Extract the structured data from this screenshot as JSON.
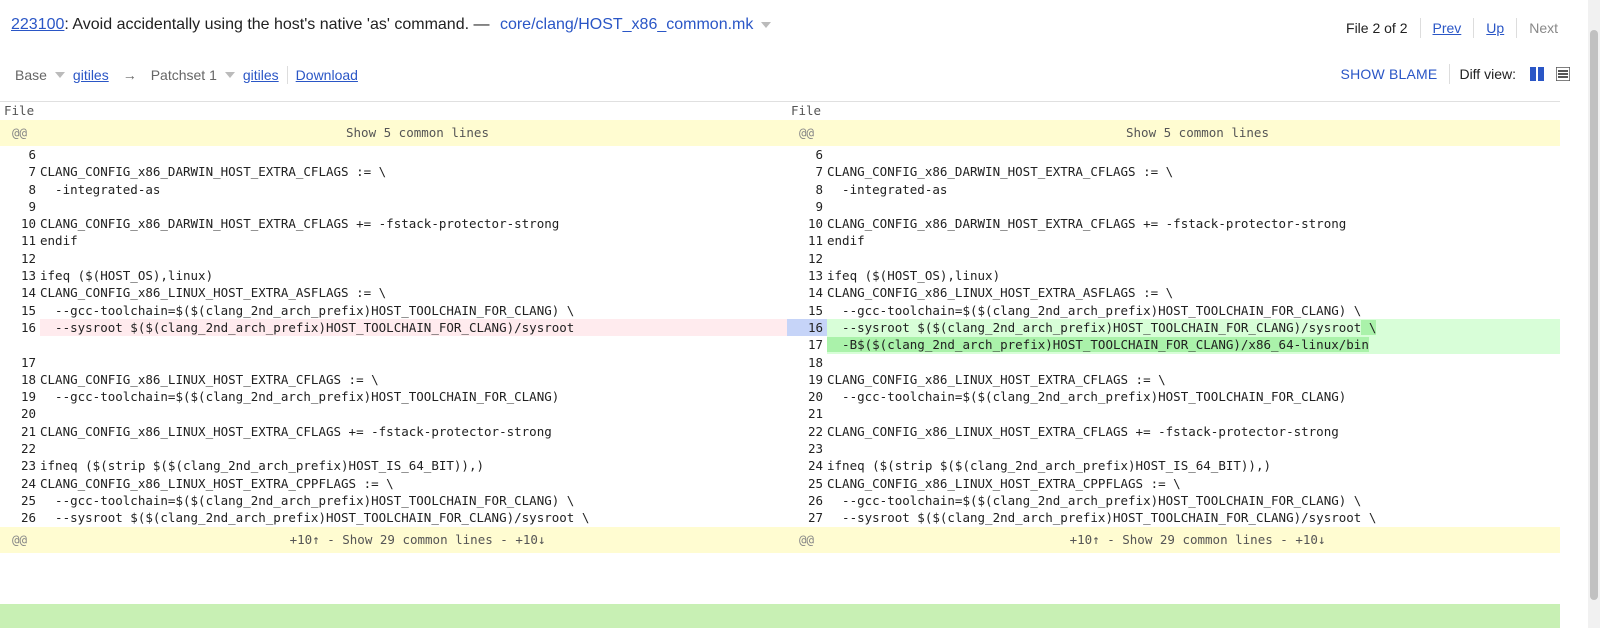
{
  "header": {
    "change_number": "223100",
    "subject": ": Avoid accidentally using the host's native 'as' command. —",
    "file_path": "core/clang/HOST_x86_common.mk",
    "file_position": "File 2 of 2",
    "prev_label": "Prev",
    "up_label": "Up",
    "next_label": "Next"
  },
  "subheader": {
    "base_label": "Base",
    "base_gitiles": "gitiles",
    "arrow": "→",
    "patchset_label": "Patchset 1",
    "patchset_gitiles": "gitiles",
    "download_label": "Download",
    "show_blame_label": "SHOW BLAME",
    "diff_view_label": "Diff view:"
  },
  "diff": {
    "file_label": "File",
    "context_marker": "@@",
    "top_context": "Show 5 common lines",
    "bottom_context": "+10↑  -  Show 29 common lines  -  +10↓",
    "left": [
      {
        "n": "6",
        "t": ""
      },
      {
        "n": "7",
        "t": "CLANG_CONFIG_x86_DARWIN_HOST_EXTRA_CFLAGS := \\"
      },
      {
        "n": "8",
        "t": "  -integrated-as"
      },
      {
        "n": "9",
        "t": ""
      },
      {
        "n": "10",
        "t": "CLANG_CONFIG_x86_DARWIN_HOST_EXTRA_CFLAGS += -fstack-protector-strong"
      },
      {
        "n": "11",
        "t": "endif"
      },
      {
        "n": "12",
        "t": ""
      },
      {
        "n": "13",
        "t": "ifeq ($(HOST_OS),linux)"
      },
      {
        "n": "14",
        "t": "CLANG_CONFIG_x86_LINUX_HOST_EXTRA_ASFLAGS := \\"
      },
      {
        "n": "15",
        "t": "  --gcc-toolchain=$($(clang_2nd_arch_prefix)HOST_TOOLCHAIN_FOR_CLANG) \\"
      },
      {
        "n": "16",
        "t": "  --sysroot $($(clang_2nd_arch_prefix)HOST_TOOLCHAIN_FOR_CLANG)/sysroot",
        "k": "rm"
      },
      {
        "n": "",
        "t": "",
        "k": "blank"
      },
      {
        "n": "17",
        "t": ""
      },
      {
        "n": "18",
        "t": "CLANG_CONFIG_x86_LINUX_HOST_EXTRA_CFLAGS := \\"
      },
      {
        "n": "19",
        "t": "  --gcc-toolchain=$($(clang_2nd_arch_prefix)HOST_TOOLCHAIN_FOR_CLANG)"
      },
      {
        "n": "20",
        "t": ""
      },
      {
        "n": "21",
        "t": "CLANG_CONFIG_x86_LINUX_HOST_EXTRA_CFLAGS += -fstack-protector-strong"
      },
      {
        "n": "22",
        "t": ""
      },
      {
        "n": "23",
        "t": "ifneq ($(strip $($(clang_2nd_arch_prefix)HOST_IS_64_BIT)),)"
      },
      {
        "n": "24",
        "t": "CLANG_CONFIG_x86_LINUX_HOST_EXTRA_CPPFLAGS := \\"
      },
      {
        "n": "25",
        "t": "  --gcc-toolchain=$($(clang_2nd_arch_prefix)HOST_TOOLCHAIN_FOR_CLANG) \\"
      },
      {
        "n": "26",
        "t": "  --sysroot $($(clang_2nd_arch_prefix)HOST_TOOLCHAIN_FOR_CLANG)/sysroot \\"
      }
    ],
    "right": [
      {
        "n": "6",
        "t": ""
      },
      {
        "n": "7",
        "t": "CLANG_CONFIG_x86_DARWIN_HOST_EXTRA_CFLAGS := \\"
      },
      {
        "n": "8",
        "t": "  -integrated-as"
      },
      {
        "n": "9",
        "t": ""
      },
      {
        "n": "10",
        "t": "CLANG_CONFIG_x86_DARWIN_HOST_EXTRA_CFLAGS += -fstack-protector-strong"
      },
      {
        "n": "11",
        "t": "endif"
      },
      {
        "n": "12",
        "t": ""
      },
      {
        "n": "13",
        "t": "ifeq ($(HOST_OS),linux)"
      },
      {
        "n": "14",
        "t": "CLANG_CONFIG_x86_LINUX_HOST_EXTRA_ASFLAGS := \\"
      },
      {
        "n": "15",
        "t": "  --gcc-toolchain=$($(clang_2nd_arch_prefix)HOST_TOOLCHAIN_FOR_CLANG) \\"
      },
      {
        "n": "16",
        "t": "  --sysroot $($(clang_2nd_arch_prefix)HOST_TOOLCHAIN_FOR_CLANG)/sysroot",
        "h": " \\",
        "k": "ad",
        "cur": true
      },
      {
        "n": "17",
        "t": "",
        "h": "  -B$($(clang_2nd_arch_prefix)HOST_TOOLCHAIN_FOR_CLANG)/x86_64-linux/bin",
        "k": "ad"
      },
      {
        "n": "18",
        "t": ""
      },
      {
        "n": "19",
        "t": "CLANG_CONFIG_x86_LINUX_HOST_EXTRA_CFLAGS := \\"
      },
      {
        "n": "20",
        "t": "  --gcc-toolchain=$($(clang_2nd_arch_prefix)HOST_TOOLCHAIN_FOR_CLANG)"
      },
      {
        "n": "21",
        "t": ""
      },
      {
        "n": "22",
        "t": "CLANG_CONFIG_x86_LINUX_HOST_EXTRA_CFLAGS += -fstack-protector-strong"
      },
      {
        "n": "23",
        "t": ""
      },
      {
        "n": "24",
        "t": "ifneq ($(strip $($(clang_2nd_arch_prefix)HOST_IS_64_BIT)),)"
      },
      {
        "n": "25",
        "t": "CLANG_CONFIG_x86_LINUX_HOST_EXTRA_CPPFLAGS := \\"
      },
      {
        "n": "26",
        "t": "  --gcc-toolchain=$($(clang_2nd_arch_prefix)HOST_TOOLCHAIN_FOR_CLANG) \\"
      },
      {
        "n": "27",
        "t": "  --sysroot $($(clang_2nd_arch_prefix)HOST_TOOLCHAIN_FOR_CLANG)/sysroot \\"
      }
    ]
  },
  "colors": {
    "link": "#2a56c6",
    "removed": "#ffebee",
    "added": "#d8fed8",
    "added_highlight": "#aaf2aa",
    "context": "#fffcd1"
  },
  "icons": {
    "side_by_side": "side-by-side-icon",
    "unified": "unified-icon",
    "dropdown": "chevron-down-icon"
  }
}
